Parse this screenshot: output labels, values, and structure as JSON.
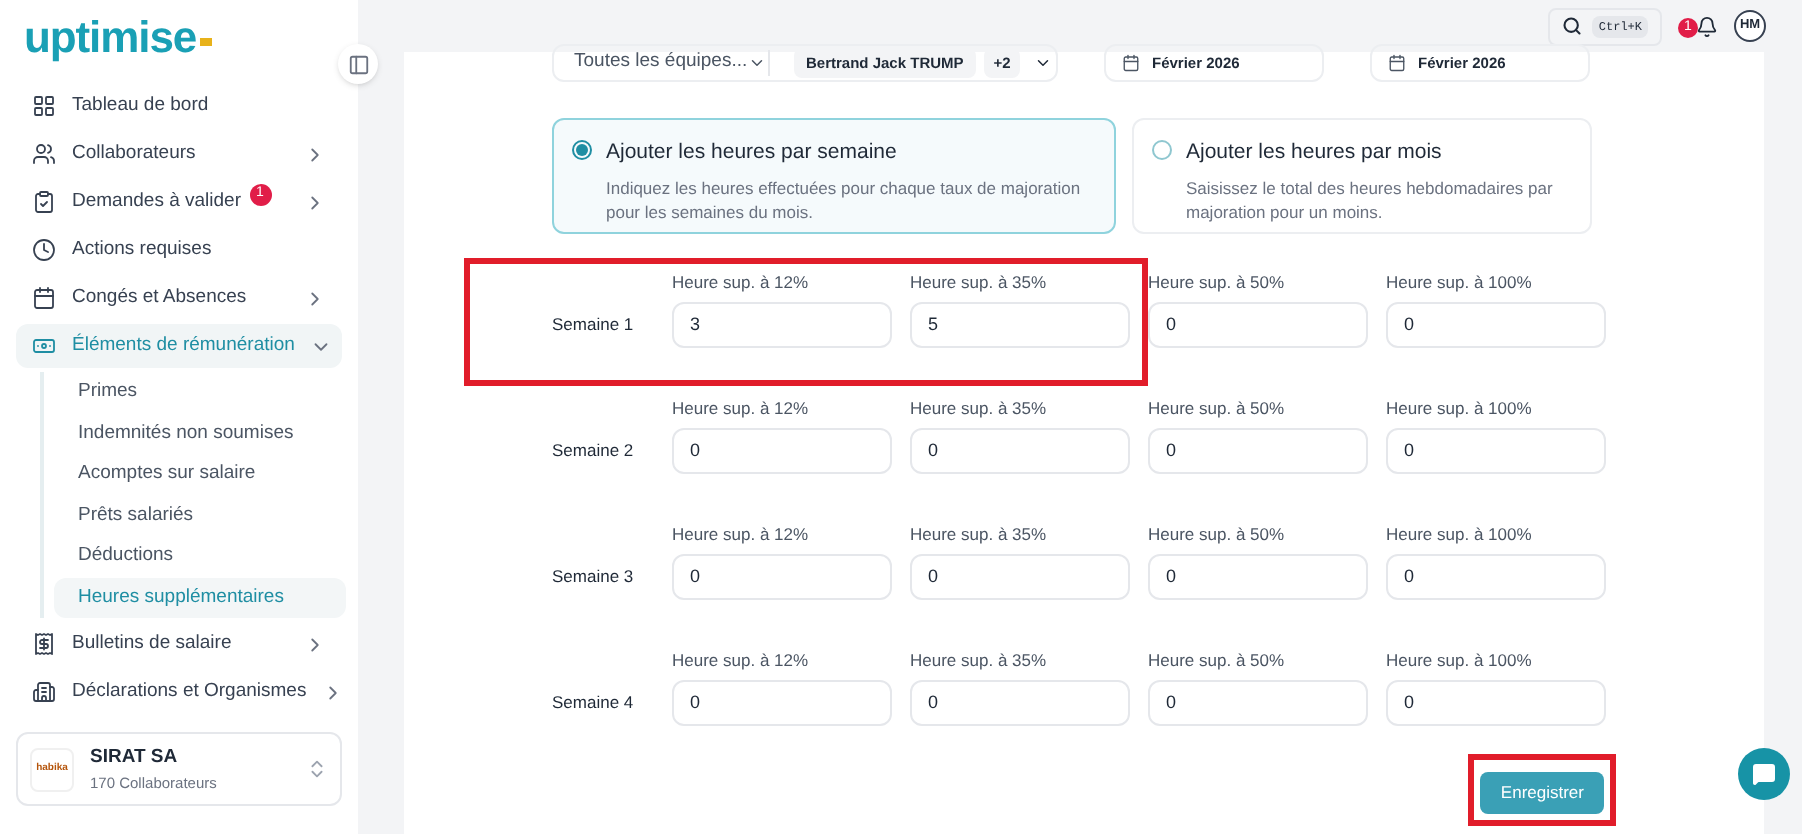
{
  "brand": {
    "logo": "uptimise"
  },
  "sidebar": {
    "items": [
      {
        "label": "Tableau de bord",
        "expandable": false,
        "selected": false
      },
      {
        "label": "Collaborateurs",
        "expandable": true,
        "expanded": false,
        "selected": false
      },
      {
        "label": "Demandes à valider",
        "expandable": true,
        "expanded": false,
        "selected": false,
        "badge": "1"
      },
      {
        "label": "Actions requises",
        "expandable": false,
        "selected": false
      },
      {
        "label": "Congés et Absences",
        "expandable": true,
        "expanded": false,
        "selected": false
      },
      {
        "label": "Éléments de rémunération",
        "expandable": true,
        "expanded": true,
        "selected": true,
        "children": [
          {
            "label": "Primes",
            "selected": false
          },
          {
            "label": "Indemnités non soumises",
            "selected": false
          },
          {
            "label": "Acomptes sur salaire",
            "selected": false
          },
          {
            "label": "Prêts salariés",
            "selected": false
          },
          {
            "label": "Déductions",
            "selected": false
          },
          {
            "label": "Heures supplémentaires",
            "selected": true
          }
        ]
      },
      {
        "label": "Bulletins de salaire",
        "expandable": true,
        "expanded": false,
        "selected": false
      },
      {
        "label": "Déclarations et Organismes",
        "expandable": true,
        "expanded": false,
        "selected": false
      }
    ],
    "company": {
      "logo": "habika",
      "name": "SIRAT SA",
      "subtitle": "170 Collaborateurs"
    }
  },
  "topbar": {
    "shortcut": "Ctrl+K",
    "notifications": "1",
    "avatar": "HM"
  },
  "filters": {
    "team": "Toutes les équipes...",
    "person": "Bertrand Jack TRUMP",
    "more": "+2",
    "date_from": "Février 2026",
    "date_to": "Février 2026"
  },
  "modes": [
    {
      "title": "Ajouter les heures par semaine",
      "description": "Indiquez les heures effectuées pour chaque taux de majoration pour les semaines du mois.",
      "selected": true
    },
    {
      "title": "Ajouter les heures par mois",
      "description": "Saisissez le total des heures hebdomadaires par majoration pour un moins.",
      "selected": false
    }
  ],
  "weeks": [
    {
      "label": "Semaine 1",
      "highlighted": true,
      "fields": [
        {
          "label": "Heure sup. à 12%",
          "value": "3"
        },
        {
          "label": "Heure sup. à 35%",
          "value": "5"
        },
        {
          "label": "Heure sup. à 50%",
          "value": "0"
        },
        {
          "label": "Heure sup. à 100%",
          "value": "0"
        }
      ]
    },
    {
      "label": "Semaine 2",
      "highlighted": false,
      "fields": [
        {
          "label": "Heure sup. à 12%",
          "value": "0"
        },
        {
          "label": "Heure sup. à 35%",
          "value": "0"
        },
        {
          "label": "Heure sup. à 50%",
          "value": "0"
        },
        {
          "label": "Heure sup. à 100%",
          "value": "0"
        }
      ]
    },
    {
      "label": "Semaine 3",
      "highlighted": false,
      "fields": [
        {
          "label": "Heure sup. à 12%",
          "value": "0"
        },
        {
          "label": "Heure sup. à 35%",
          "value": "0"
        },
        {
          "label": "Heure sup. à 50%",
          "value": "0"
        },
        {
          "label": "Heure sup. à 100%",
          "value": "0"
        }
      ]
    },
    {
      "label": "Semaine 4",
      "highlighted": false,
      "fields": [
        {
          "label": "Heure sup. à 12%",
          "value": "0"
        },
        {
          "label": "Heure sup. à 35%",
          "value": "0"
        },
        {
          "label": "Heure sup. à 50%",
          "value": "0"
        },
        {
          "label": "Heure sup. à 100%",
          "value": "0"
        }
      ]
    }
  ],
  "save": {
    "label": "Enregistrer",
    "highlighted": true
  }
}
